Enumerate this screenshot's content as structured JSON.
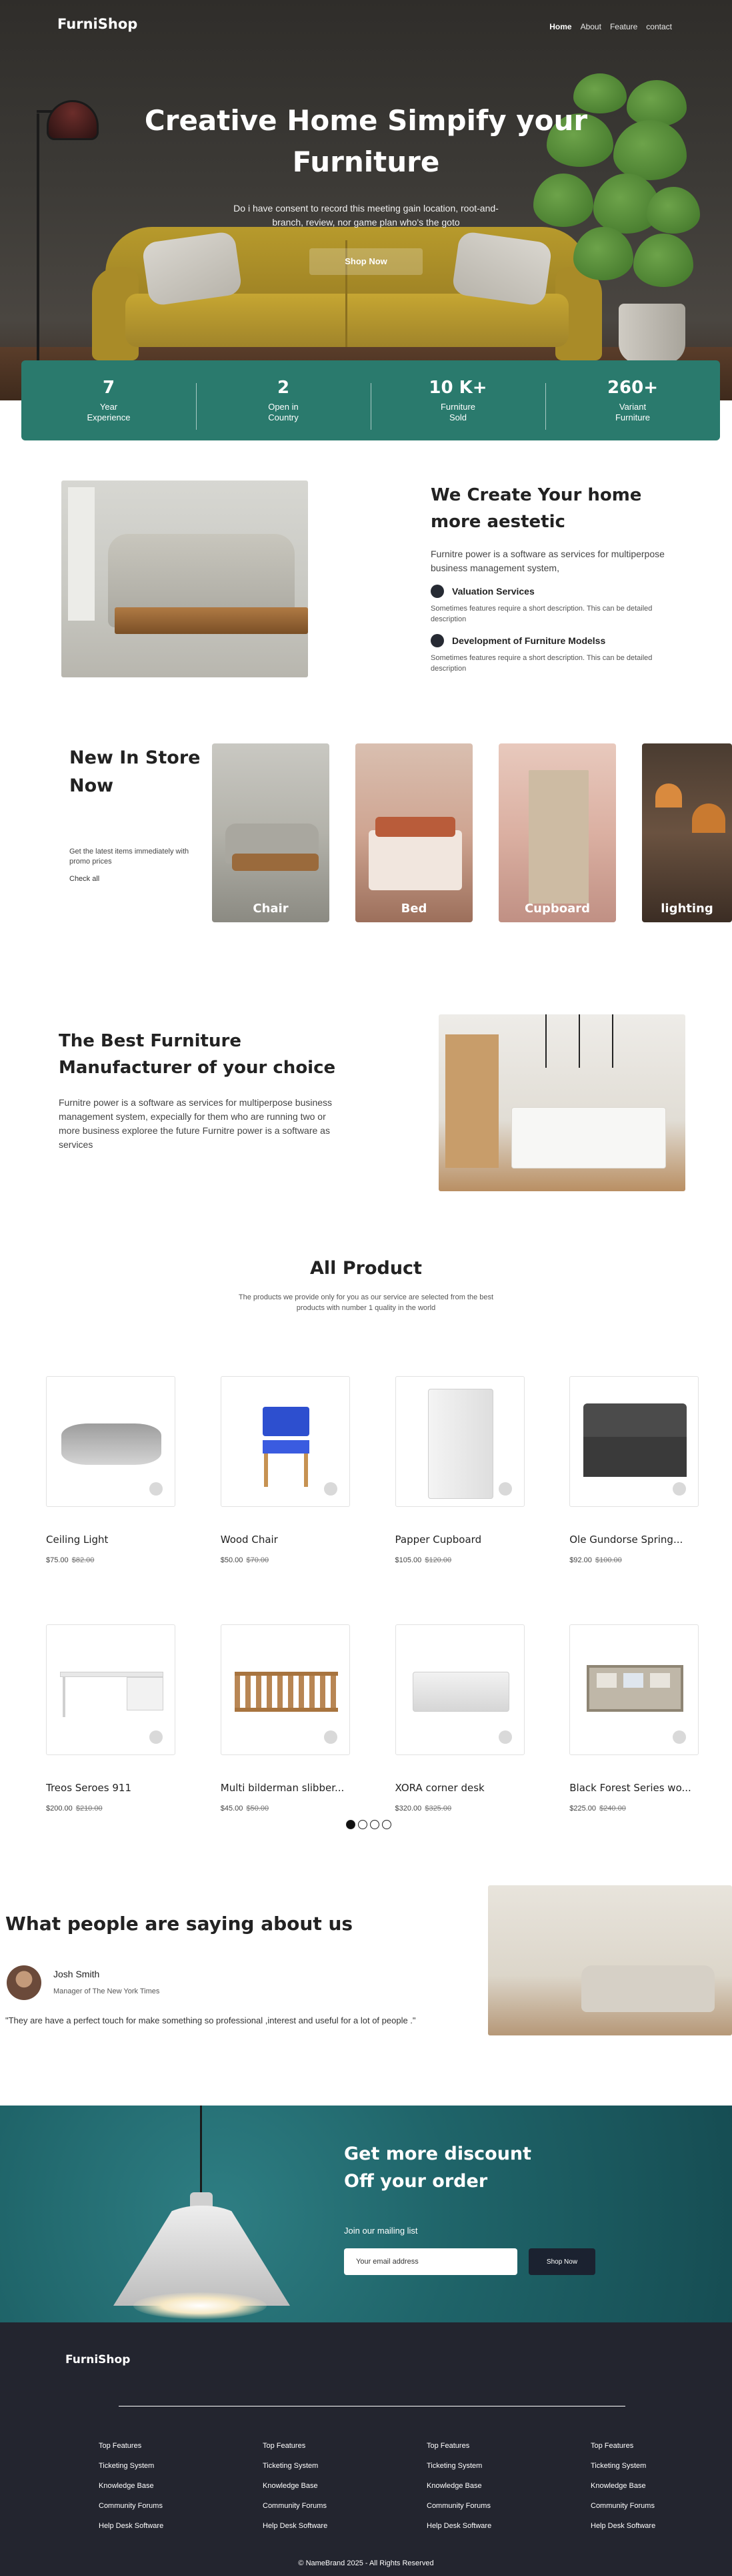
{
  "brand": "FurniShop",
  "nav": {
    "items": [
      {
        "label": "Home",
        "active": true
      },
      {
        "label": "About",
        "active": false
      },
      {
        "label": "Feature",
        "active": false
      },
      {
        "label": "contact",
        "active": false
      }
    ]
  },
  "hero": {
    "title": "Creative Home Simpify your Furniture",
    "subtitle": "Do i have consent to record this meeting gain location, root-and-branch, review, nor game plan who's the goto",
    "button": "Shop Now"
  },
  "stats": [
    {
      "value": "7",
      "label_1": "Year",
      "label_2": "Experience"
    },
    {
      "value": "2",
      "label_1": "Open in",
      "label_2": "Country"
    },
    {
      "value": "10 K+",
      "label_1": "Furniture",
      "label_2": "Sold"
    },
    {
      "value": "260+",
      "label_1": "Variant",
      "label_2": "Furniture"
    }
  ],
  "create": {
    "title": "We Create Your home more aestetic",
    "body": "Furnitre power is a software as services for multiperpose business management system,",
    "features": [
      {
        "title": "Valuation Services",
        "desc": "Sometimes features require a short description. This can be detailed description"
      },
      {
        "title": "Development of Furniture Modelss",
        "desc": "Sometimes features require a short description. This can be detailed description"
      }
    ]
  },
  "store": {
    "title": "New In Store Now",
    "desc": "Get the latest items immediately with promo prices",
    "link": "Check all",
    "cards": [
      "Chair",
      "Bed",
      "Cupboard",
      "lighting"
    ]
  },
  "best": {
    "title": "The Best Furniture Manufacturer of your choice",
    "body": "Furnitre power is a software as services for multiperpose business management system, expecially for them who are running two or more business exploree the future Furnitre power is a software as services"
  },
  "products": {
    "title": "All Product",
    "subtitle": "The products we provide only for you as our service are selected from the best products with number 1 quality in the world",
    "items": [
      {
        "name": "Ceiling Light",
        "price": "$75.00",
        "old_price": "$82.00"
      },
      {
        "name": "Wood Chair",
        "price": "$50.00",
        "old_price": "$70.00"
      },
      {
        "name": "Papper Cupboard",
        "price": "$105.00",
        "old_price": "$120.00"
      },
      {
        "name": "Ole Gundorse Spring...",
        "price": "$92.00",
        "old_price": "$100.00"
      },
      {
        "name": "Treos Seroes 911",
        "price": "$200.00",
        "old_price": "$210.00"
      },
      {
        "name": "Multi bilderman slibber...",
        "price": "$45.00",
        "old_price": "$50.00"
      },
      {
        "name": "XORA corner desk",
        "price": "$320.00",
        "old_price": "$325.00"
      },
      {
        "name": "Black Forest Series wo...",
        "price": "$225.00",
        "old_price": "$240.00"
      }
    ],
    "pages": 4,
    "current_page": 1
  },
  "testimonial": {
    "title": "What people are saying about us",
    "name": "Josh Smith",
    "role": "Manager of The New York Times",
    "quote": "\"They are have a perfect touch for make something so professional ,interest and useful for a lot of people .\""
  },
  "discount": {
    "title": "Get more discount Off your order",
    "mailing": "Join our mailing list",
    "email_placeholder": "Your email address",
    "button": "Shop Now"
  },
  "footer": {
    "brand": "FurniShop",
    "columns": [
      [
        "Top Features",
        "Ticketing System",
        "Knowledge Base",
        "Community Forums",
        "Help Desk Software"
      ],
      [
        "Top Features",
        "Ticketing System",
        "Knowledge Base",
        "Community Forums",
        "Help Desk Software"
      ],
      [
        "Top Features",
        "Ticketing System",
        "Knowledge Base",
        "Community Forums",
        "Help Desk Software"
      ],
      [
        "Top Features",
        "Ticketing System",
        "Knowledge Base",
        "Community Forums",
        "Help Desk Software"
      ]
    ],
    "copyright": "© NameBrand 2025 - All Rights Reserved"
  },
  "colors": {
    "accent_teal": "#2a7a6d",
    "footer_bg": "#23252f",
    "discount_bg": "#1f6469"
  }
}
